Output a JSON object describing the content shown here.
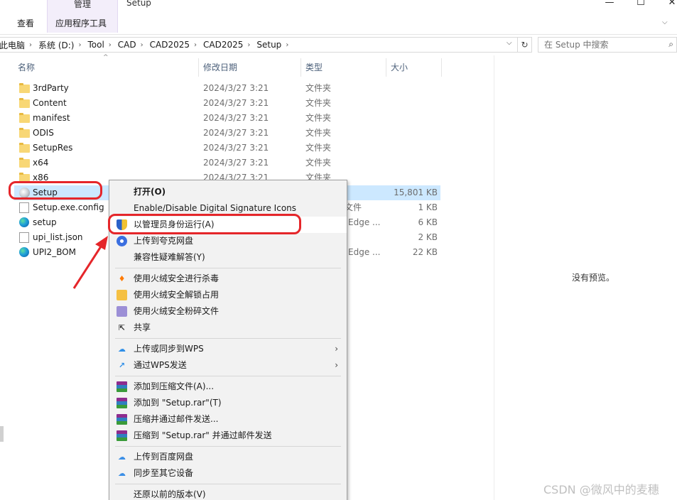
{
  "ribbon": {
    "contextual_group": "管理",
    "window_title": "Setup",
    "tabs": [
      "查看",
      "应用程序工具"
    ],
    "window_buttons": [
      "—",
      "☐",
      "✕"
    ],
    "collapse": "⌵"
  },
  "address": {
    "crumbs": [
      "此电脑",
      "系统 (D:)",
      "Tool",
      "CAD",
      "CAD2025",
      "CAD2025",
      "Setup"
    ],
    "separator": "›",
    "refresh": "↻",
    "search_placeholder": "在 Setup 中搜索",
    "search_icon": "⌕"
  },
  "columns": {
    "name": "名称",
    "date": "修改日期",
    "type": "类型",
    "size": "大小"
  },
  "files": [
    {
      "name": "3rdParty",
      "date": "2024/3/27 3:21",
      "type": "文件夹",
      "size": "",
      "icon": "folder"
    },
    {
      "name": "Content",
      "date": "2024/3/27 3:21",
      "type": "文件夹",
      "size": "",
      "icon": "folder"
    },
    {
      "name": "manifest",
      "date": "2024/3/27 3:21",
      "type": "文件夹",
      "size": "",
      "icon": "folder"
    },
    {
      "name": "ODIS",
      "date": "2024/3/27 3:21",
      "type": "文件夹",
      "size": "",
      "icon": "folder"
    },
    {
      "name": "SetupRes",
      "date": "2024/3/27 3:21",
      "type": "文件夹",
      "size": "",
      "icon": "folder"
    },
    {
      "name": "x64",
      "date": "2024/3/27 3:21",
      "type": "文件夹",
      "size": "",
      "icon": "folder"
    },
    {
      "name": "x86",
      "date": "2024/3/27 3:21",
      "type": "文件夹",
      "size": "",
      "icon": "folder"
    },
    {
      "name": "Setup",
      "date": "",
      "type": "",
      "size": "15,801 KB",
      "icon": "setup"
    },
    {
      "name": "Setup.exe.config",
      "date": "",
      "type": "文件",
      "size": "1 KB",
      "icon": "doc"
    },
    {
      "name": "setup",
      "date": "",
      "type": "Edge ...",
      "size": "6 KB",
      "icon": "edge"
    },
    {
      "name": "upi_list.json",
      "date": "",
      "type": "",
      "size": "2 KB",
      "icon": "doc"
    },
    {
      "name": "UPI2_BOM",
      "date": "",
      "type": "Edge ...",
      "size": "22 KB",
      "icon": "edge"
    }
  ],
  "preview": {
    "empty_text": "没有预览。"
  },
  "context_menu": {
    "items": [
      {
        "label": "打开(O)",
        "icon": "none"
      },
      {
        "label": "Enable/Disable Digital Signature Icons",
        "icon": "none"
      },
      {
        "label": "以管理员身份运行(A)",
        "icon": "uac-shield"
      },
      {
        "label": "上传到夸克网盘",
        "icon": "quark"
      },
      {
        "label": "兼容性疑难解答(Y)",
        "icon": "none"
      },
      {
        "label": "使用火绒安全进行杀毒",
        "icon": "huorong-scan"
      },
      {
        "label": "使用火绒安全解锁占用",
        "icon": "huorong-unlock"
      },
      {
        "label": "使用火绒安全粉碎文件",
        "icon": "huorong-shred"
      },
      {
        "label": "共享",
        "icon": "share"
      },
      {
        "label": "上传或同步到WPS",
        "icon": "wps-cloud"
      },
      {
        "label": "通过WPS发送",
        "icon": "wps-send"
      },
      {
        "label": "添加到压缩文件(A)...",
        "icon": "winrar"
      },
      {
        "label": "添加到 \"Setup.rar\"(T)",
        "icon": "winrar"
      },
      {
        "label": "压缩并通过邮件发送...",
        "icon": "winrar"
      },
      {
        "label": "压缩到 \"Setup.rar\" 并通过邮件发送",
        "icon": "winrar"
      },
      {
        "label": "上传到百度网盘",
        "icon": "baidu"
      },
      {
        "label": "同步至其它设备",
        "icon": "baidu"
      },
      {
        "label": "还原以前的版本(V)",
        "icon": "none"
      }
    ],
    "submenu_arrow": "›"
  },
  "watermark": "CSDN @微风中的麦穗",
  "colors": {
    "selection": "#cce8ff",
    "annotation": "#e5262a",
    "contextual_tab": "#f3eefa"
  }
}
